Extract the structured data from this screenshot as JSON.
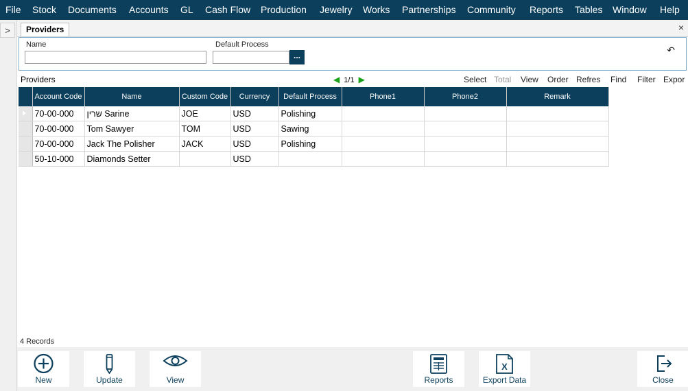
{
  "menu": [
    "File",
    "Stock",
    "Documents",
    "Accounts",
    "GL",
    "Cash Flow",
    "Production",
    "Jewelry",
    "Works",
    "Partnerships",
    "Community",
    "Reports",
    "Tables",
    "Window",
    "Help"
  ],
  "left_strip": {
    "expand_glyph": ">"
  },
  "tab": {
    "label": "Providers",
    "close_glyph": "×"
  },
  "filters": {
    "name_label": "Name",
    "name_value": "",
    "process_label": "Default Process",
    "process_value": "",
    "lookup_label": "...",
    "reset_glyph": "↶"
  },
  "grid": {
    "title": "Providers",
    "page": "1/1",
    "toolbar": [
      "Select",
      "Total",
      "View",
      "Order",
      "Refres",
      "Find",
      "Filter",
      "Expor"
    ],
    "disabled_toolbar": [
      "Total"
    ],
    "columns": [
      "Account Code",
      "Name",
      "Custom Code",
      "Currency",
      "Default Process",
      "Phone1",
      "Phone2",
      "Remark"
    ],
    "rows": [
      {
        "account_code": "70-00-000",
        "name": "שרין Sarine",
        "custom_code": "JOE",
        "currency": "USD",
        "default_process": "Polishing",
        "phone1": "",
        "phone2": "",
        "remark": ""
      },
      {
        "account_code": "70-00-000",
        "name": "Tom Sawyer",
        "custom_code": "TOM",
        "currency": "USD",
        "default_process": "Sawing",
        "phone1": "",
        "phone2": "",
        "remark": ""
      },
      {
        "account_code": "70-00-000",
        "name": "Jack The Polisher",
        "custom_code": "JACK",
        "currency": "USD",
        "default_process": "Polishing",
        "phone1": "",
        "phone2": "",
        "remark": ""
      },
      {
        "account_code": "50-10-000",
        "name": "Diamonds Setter",
        "custom_code": "",
        "currency": "USD",
        "default_process": "",
        "phone1": "",
        "phone2": "",
        "remark": ""
      }
    ],
    "record_count": "4 Records"
  },
  "bottom_buttons": [
    {
      "label": "New",
      "icon": "plus-circle-icon"
    },
    {
      "label": "Update",
      "icon": "pencil-icon"
    },
    {
      "label": "View",
      "icon": "eye-icon"
    },
    {
      "label": "Reports",
      "icon": "report-icon"
    },
    {
      "label": "Export Data",
      "icon": "excel-icon"
    },
    {
      "label": "Close",
      "icon": "exit-icon"
    }
  ],
  "colors": {
    "header_bg": "#0b3f5c",
    "pager_arrow": "#1aa31a",
    "accent_border": "#7aa7c7"
  }
}
